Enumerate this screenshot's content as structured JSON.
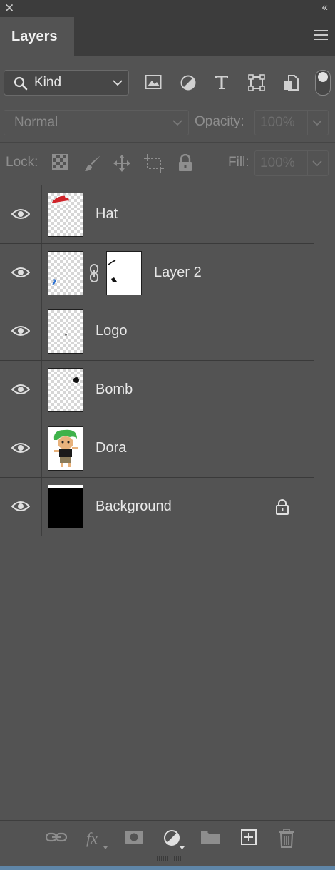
{
  "panel": {
    "title": "Layers"
  },
  "filter": {
    "kind_label": "Kind"
  },
  "blend": {
    "mode": "Normal",
    "opacity_label": "Opacity:",
    "opacity_value": "100%"
  },
  "lock": {
    "label": "Lock:",
    "fill_label": "Fill:",
    "fill_value": "100%"
  },
  "layers": [
    {
      "name": "Hat",
      "visible": true,
      "thumbnail": "santa-hat"
    },
    {
      "name": "Layer 2",
      "visible": true,
      "thumbnail": "blue-mark",
      "has_mask": true
    },
    {
      "name": "Logo",
      "visible": true,
      "thumbnail": "tiny-dot"
    },
    {
      "name": "Bomb",
      "visible": true,
      "thumbnail": "black-dot"
    },
    {
      "name": "Dora",
      "visible": true,
      "thumbnail": "dora-character"
    },
    {
      "name": "Background",
      "visible": true,
      "thumbnail": "black-fill",
      "locked": true
    }
  ],
  "icons": {
    "filters": [
      "image-filter-icon",
      "adjustment-filter-icon",
      "type-filter-icon",
      "shape-filter-icon",
      "smart-object-filter-icon"
    ],
    "locks": [
      "lock-transparent-pixels-icon",
      "lock-image-pixels-icon",
      "lock-position-icon",
      "lock-artboard-icon",
      "lock-all-icon"
    ],
    "bottom": [
      "link-layers-icon",
      "fx-icon",
      "add-mask-icon",
      "new-adjustment-icon",
      "new-group-icon",
      "new-layer-icon",
      "delete-layer-icon"
    ]
  },
  "colors": {
    "panel_bg": "#535353",
    "header_bg": "#3c3c3c",
    "accent_bar": "#5f86a8"
  }
}
